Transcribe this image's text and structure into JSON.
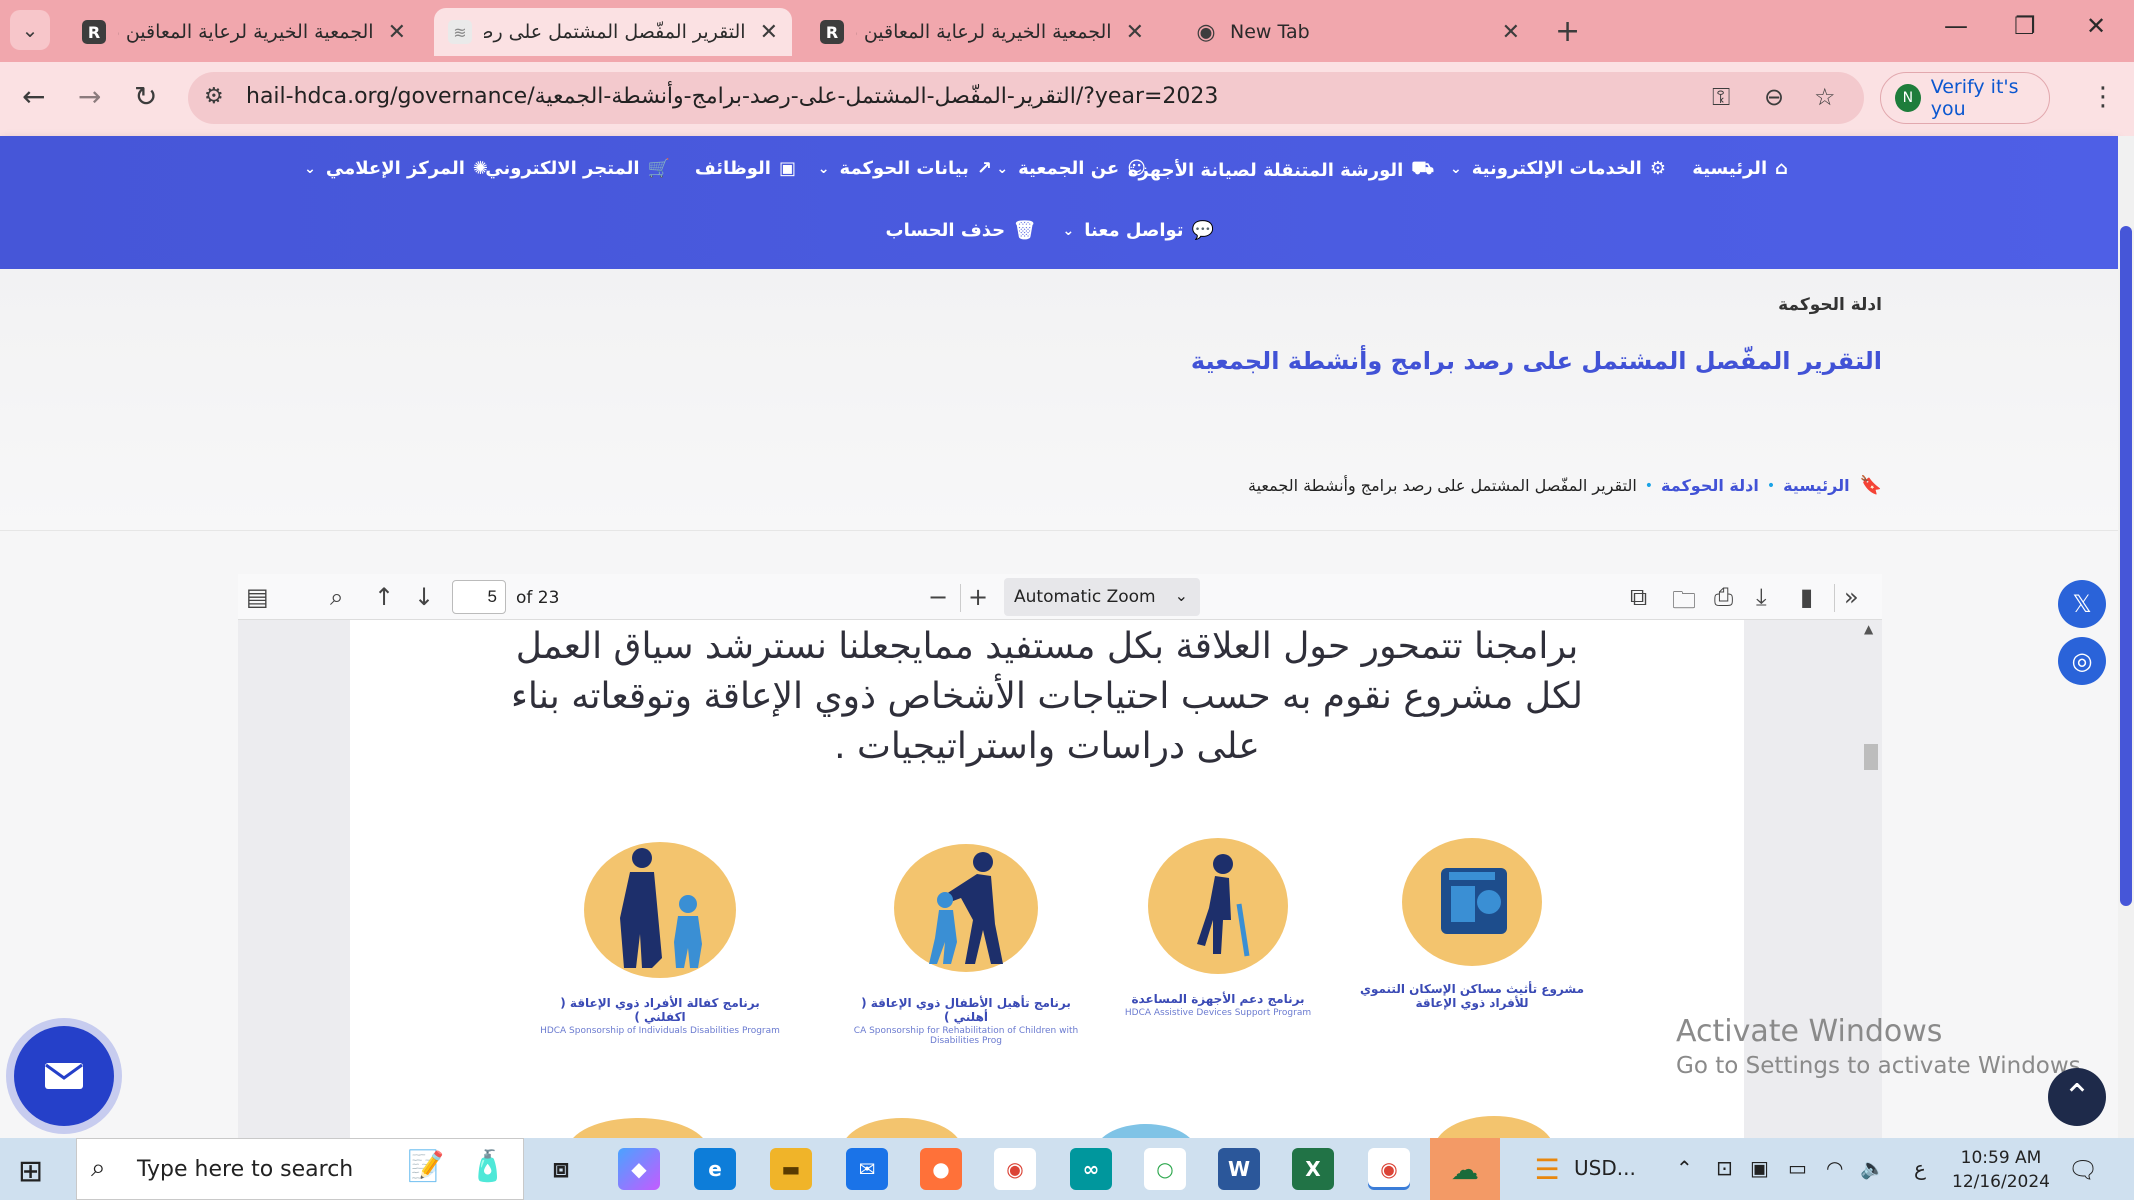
{
  "browser": {
    "tabs": [
      {
        "title": "الجمعية الخيرية لرعاية المعاقين بـ",
        "icon": "site-r-icon"
      },
      {
        "title": "التقرير المفّصل المشتمل على رصـ",
        "icon": "site-logo-icon",
        "active": true
      },
      {
        "title": "الجمعية الخيرية لرعاية المعاقين بـ",
        "icon": "site-r-icon"
      },
      {
        "title": "New Tab",
        "icon": "chrome-icon"
      }
    ],
    "url": "hail-hdca.org/governance/التقرير-المفّصل-المشتمل-على-رصد-برامج-وأنشطة-الجمعية/?year=2023",
    "verify_label": "Verify it's you",
    "verify_avatar": "N"
  },
  "site_nav": {
    "row1": [
      "الرئيسية",
      "الخدمات الإلكترونية",
      "الورشة المتنقلة لصيانة الأجهزة",
      "عن الجمعية",
      "بيانات الحوكمة",
      "الوظائف",
      "المتجر الالكتروني",
      "المركز الإعلامي"
    ],
    "row2": [
      "تواصل معنا",
      "حذف الحساب"
    ]
  },
  "hero": {
    "section": "ادلة الحوكمة",
    "title": "التقرير المفّصل المشتمل على رصد برامج وأنشطة الجمعية",
    "breadcrumb": [
      "الرئيسية",
      "ادلة الحوكمة",
      "التقرير المفّصل المشتمل على رصد برامج وأنشطة الجمعية"
    ]
  },
  "pdf_viewer": {
    "page": "5",
    "page_count": "of 23",
    "zoom": "Automatic Zoom",
    "content_lines": [
      "برامجنا تتمحور حول العلاقة بكل مستفيد ممايجعلنا نسترشد سياق العمل",
      "لكل مشروع نقوم به حسب احتياجات الأشخاص ذوي الإعاقة  وتوقعاته بناء",
      "على دراسات  واستراتيجيات ."
    ],
    "programs": [
      {
        "ar": "مشروع تأثيث مساكن الإسكان التنموي للأفراد ذوي الإعاقة",
        "en": ""
      },
      {
        "ar": "برنامج دعم الأجهزة المساعدة",
        "en": "HDCA Assistive Devices Support Program"
      },
      {
        "ar": "برنامج تأهيل الأطفال ذوي الإعاقة ( أهلني )",
        "en": "CA Sponsorship for Rehabilitation of Children with Disabilities Prog"
      },
      {
        "ar": "برنامج كفالة الأفراد ذوي الإعاقة ( اكفلني )",
        "en": "HDCA Sponsorship of Individuals Disabilities Program"
      }
    ]
  },
  "watermark": {
    "line1": "Activate Windows",
    "line2": "Go to Settings to activate Windows."
  },
  "taskbar": {
    "search_placeholder": "Type here to search",
    "currency": "USD...",
    "lang": "ع",
    "time": "10:59 AM",
    "date": "12/16/2024"
  },
  "colors": {
    "nav": "#4656d8",
    "title": "#4152d6",
    "tabstrip": "#f1a7ad"
  }
}
